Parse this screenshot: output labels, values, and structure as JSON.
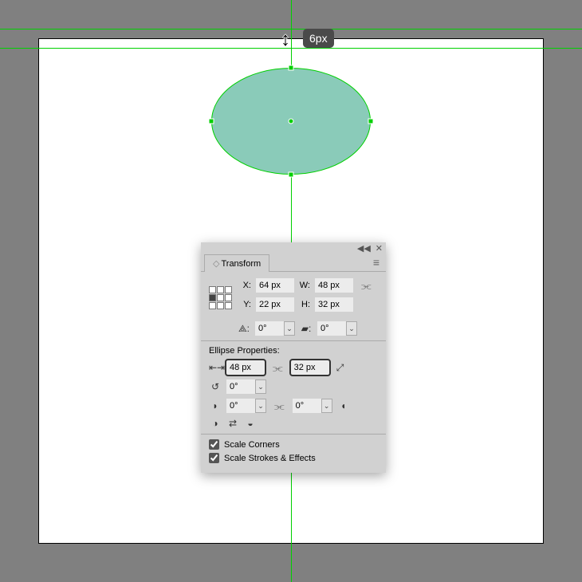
{
  "tooltip": "6px",
  "panel": {
    "title": "Transform",
    "x_label": "X:",
    "x_value": "64 px",
    "y_label": "Y:",
    "y_value": "22 px",
    "w_label": "W:",
    "w_value": "48 px",
    "h_label": "H:",
    "h_value": "32 px",
    "rotate_value": "0°",
    "shear_value": "0°",
    "ellipse_header": "Ellipse Properties:",
    "ellipse_w": "48 px",
    "ellipse_h": "32 px",
    "pie_start": "0°",
    "pie_a": "0°",
    "pie_b": "0°",
    "scale_corners": "Scale Corners",
    "scale_strokes": "Scale Strokes & Effects"
  }
}
